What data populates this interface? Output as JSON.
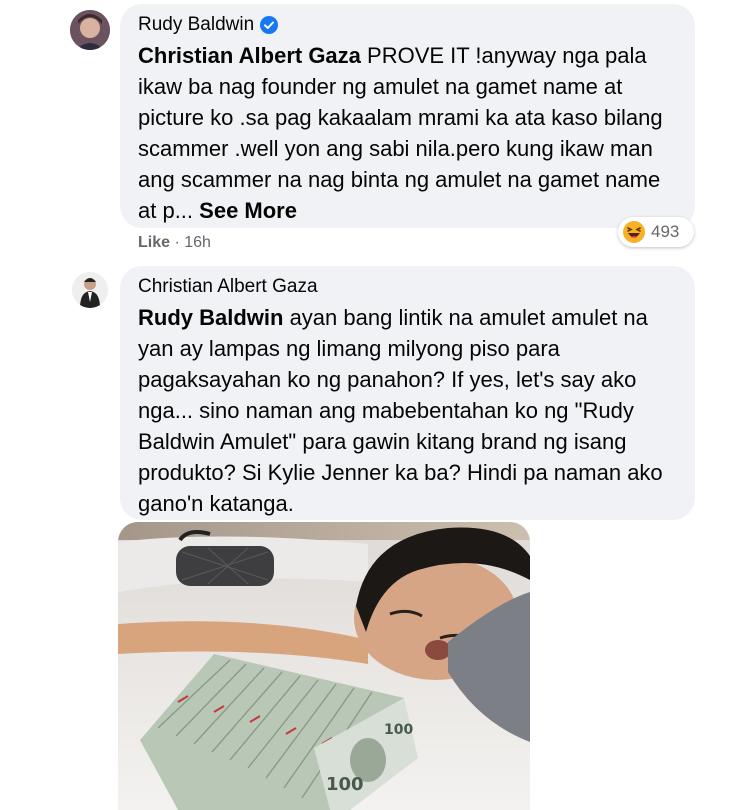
{
  "comment1": {
    "author": "Rudy Baldwin",
    "mention": "Christian Albert Gaza",
    "text": " PROVE IT !anyway nga pala ikaw ba nag founder ng amulet na gamet name at picture ko .sa pag kakaalam mrami ka ata kaso bilang scammer .well yon ang sabi nila.pero kung ikaw man ang scammer na nag binta ng amulet na gamet name at p...",
    "see_more": " See More",
    "like_label": "Like",
    "separator": " · ",
    "time": "16h",
    "reaction_count": "493",
    "reaction_icon": "haha-emoji-icon"
  },
  "comment2": {
    "author": "Christian Albert Gaza",
    "mention": "Rudy Baldwin",
    "text": " ayan bang lintik na amulet amulet na yan ay lampas ng limang milyong piso para pagaksayahan ko ng panahon? If yes, let's say ako nga... sino naman ang mabebentahan ko ng \"Rudy Baldwin Amulet\" para gawin kitang brand ng isang produkto? Si Kylie Jenner ka ba? Hindi pa naman ako gano'n katanga."
  },
  "colors": {
    "bubble": "#f0f2f5",
    "verified": "#1877f2",
    "meta": "#65676b"
  }
}
